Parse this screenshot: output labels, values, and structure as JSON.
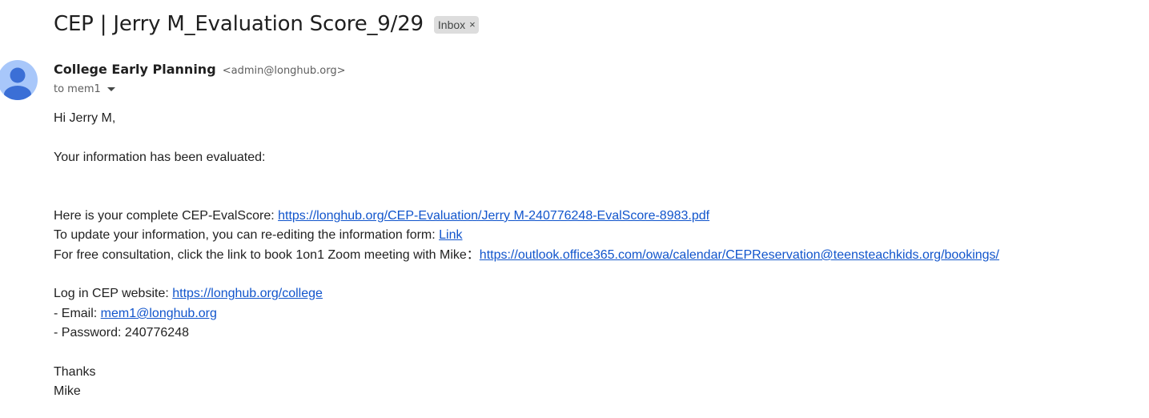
{
  "subject": "CEP | Jerry M_Evaluation Score_9/29",
  "label": {
    "name": "Inbox",
    "remove_symbol": "×"
  },
  "sender": {
    "name": "College Early Planning",
    "email": "<admin@longhub.org>"
  },
  "recipient": "to mem1",
  "body": {
    "greeting": "Hi Jerry M,",
    "evaluated": "Your information has been evaluated:",
    "evalscore_prefix": "Here is your complete CEP-EvalScore: ",
    "evalscore_link": "https://longhub.org/CEP-Evaluation/Jerry M-240776248-EvalScore-8983.pdf",
    "update_prefix": "To update your information, you can re-editing the information form: ",
    "update_link": "Link",
    "consult_prefix": "For free consultation, click the link to book 1on1 Zoom meeting with Mike：",
    "consult_link": "https://outlook.office365.com/owa/calendar/CEPReservation@teensteachkids.org/bookings/",
    "login_prefix": "Log in CEP website: ",
    "login_link": "https://longhub.org/college",
    "email_prefix": "- Email: ",
    "email_link": "mem1@longhub.org",
    "password_line": "- Password: 240776248",
    "thanks": "Thanks",
    "signature": "Mike"
  },
  "colors": {
    "link": "#1155cc",
    "avatar_bg": "#a8c7fa",
    "avatar_fg": "#0b57d0",
    "chip_bg": "#dddddd"
  },
  "icons": {
    "avatar": "person-icon",
    "recipient_toggle": "chevron-down-icon",
    "remove_label": "close-icon"
  }
}
